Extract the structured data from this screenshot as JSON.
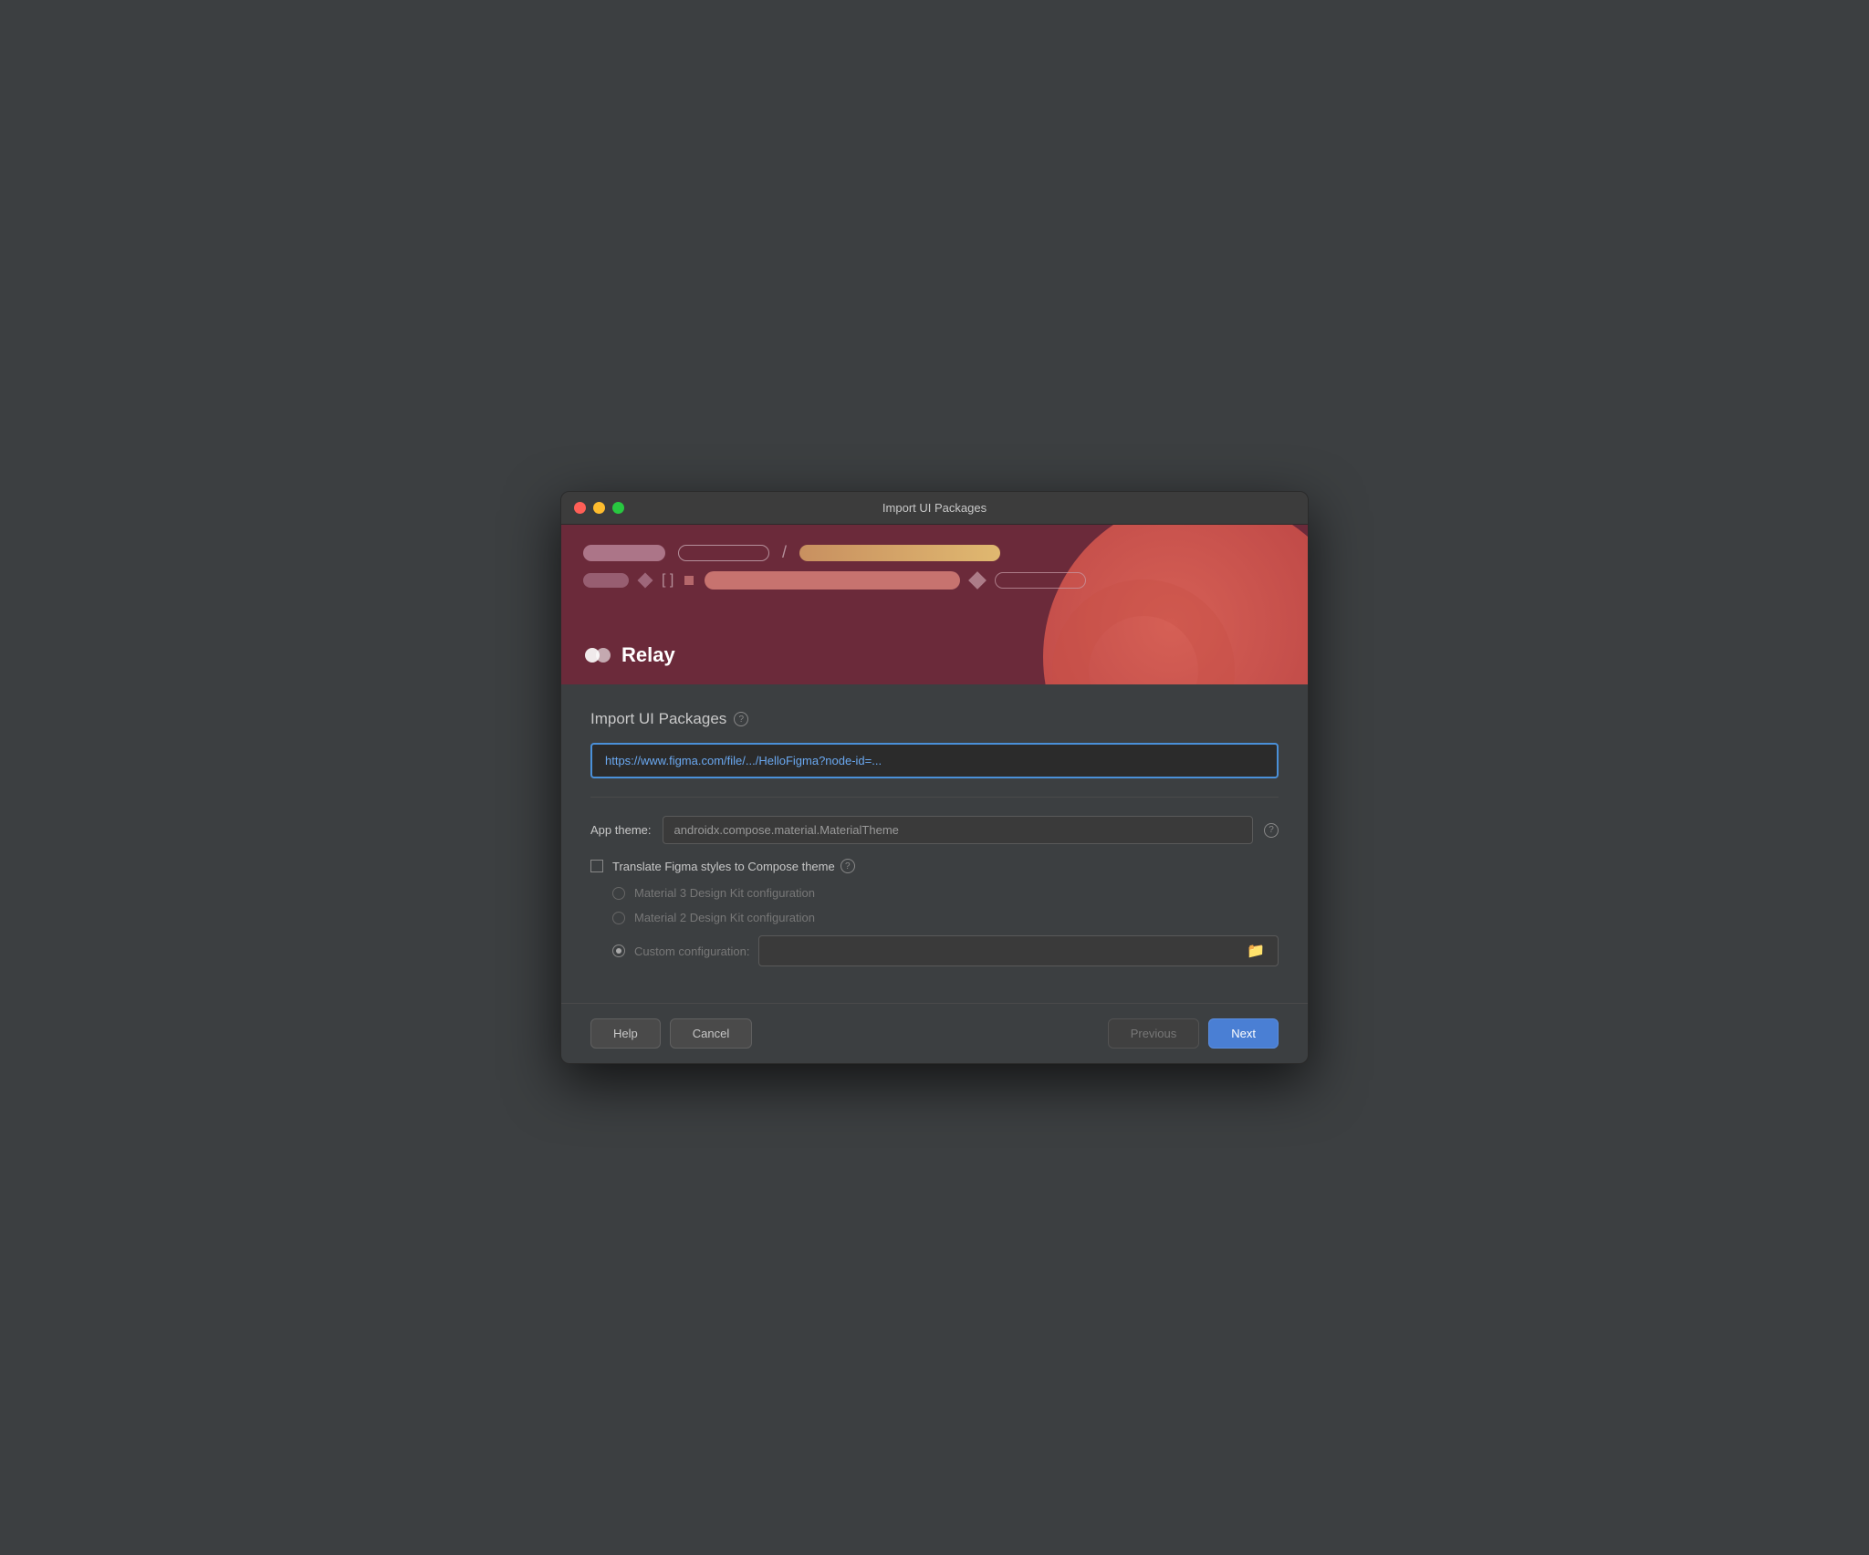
{
  "window": {
    "title": "Import UI Packages"
  },
  "titlebar": {
    "close_label": "",
    "minimize_label": "",
    "maximize_label": ""
  },
  "banner": {
    "relay_logo_text": "Relay"
  },
  "content": {
    "section_title": "Import UI Packages",
    "help_tooltip": "?",
    "url_input_value": "https://www.figma.com/file/.../HelloFigma?node-id=...",
    "url_placeholder": "https://www.figma.com/file/.../HelloFigma?node-id=...",
    "app_theme_label": "App theme:",
    "app_theme_value": "androidx.compose.material.MaterialTheme",
    "translate_label": "Translate Figma styles to Compose theme",
    "translate_help": "?",
    "material3_label": "Material 3 Design Kit configuration",
    "material2_label": "Material 2 Design Kit configuration",
    "custom_label": "Custom configuration:"
  },
  "footer": {
    "help_label": "Help",
    "cancel_label": "Cancel",
    "previous_label": "Previous",
    "next_label": "Next"
  }
}
